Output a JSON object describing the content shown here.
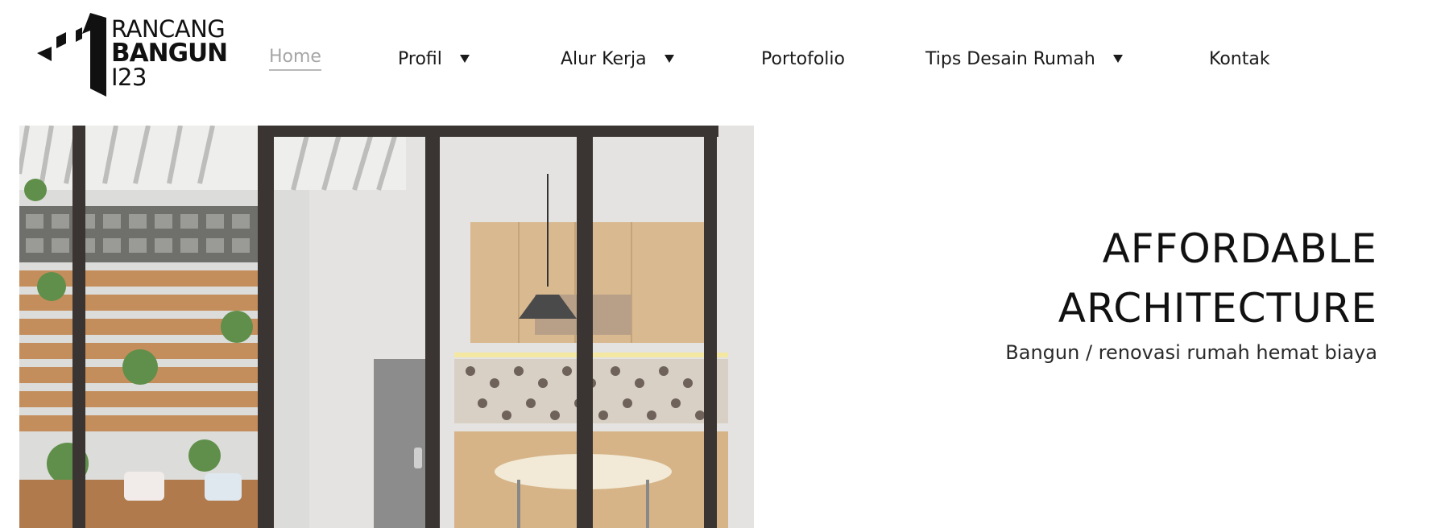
{
  "logo": {
    "line1": "RANCANG",
    "line2": "BANGUN",
    "line3": "I23"
  },
  "nav": {
    "items": [
      {
        "label": "Home",
        "active": true,
        "has_dropdown": false
      },
      {
        "label": "Profil",
        "active": false,
        "has_dropdown": true
      },
      {
        "label": "Alur Kerja",
        "active": false,
        "has_dropdown": true
      },
      {
        "label": "Portofolio",
        "active": false,
        "has_dropdown": false
      },
      {
        "label": "Tips Desain Rumah",
        "active": false,
        "has_dropdown": true
      },
      {
        "label": "Kontak",
        "active": false,
        "has_dropdown": false
      }
    ]
  },
  "hero": {
    "title_line1": "AFFORDABLE",
    "title_line2": "ARCHITECTURE",
    "subtitle": "Bangun / renovasi rumah hemat biaya",
    "image": "kitchen-interior-photo"
  },
  "colors": {
    "nav_active": "#a6a6a6",
    "text": "#1a1a1a",
    "background": "#ffffff"
  }
}
